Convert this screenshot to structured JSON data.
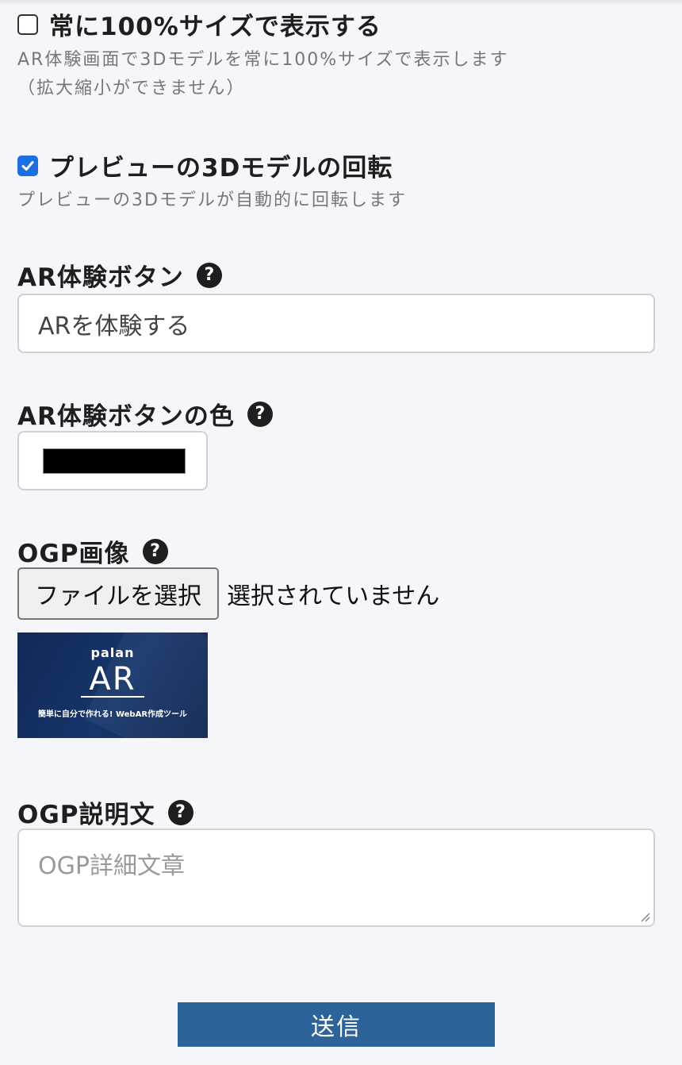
{
  "options": {
    "always_full_size": {
      "label": "常に100%サイズで表示する",
      "checked": false,
      "help_line1": "AR体験画面で3Dモデルを常に100%サイズで表示します",
      "help_line2": "（拡大縮小ができません）"
    },
    "preview_rotation": {
      "label": "プレビューの3Dモデルの回転",
      "checked": true,
      "help": "プレビューの3Dモデルが自動的に回転します"
    }
  },
  "ar_button": {
    "label": "AR体験ボタン",
    "value": "ARを体験する"
  },
  "ar_button_color": {
    "label": "AR体験ボタンの色",
    "value": "#000000"
  },
  "ogp_image": {
    "label": "OGP画像",
    "choose_file_label": "ファイルを選択",
    "file_status": "選択されていません",
    "preview": {
      "brand_small": "palan",
      "brand_large": "AR",
      "tagline": "簡単に自分で作れる! WebAR作成ツール"
    }
  },
  "ogp_description": {
    "label": "OGP説明文",
    "placeholder": "OGP詳細文章"
  },
  "help_icon_glyph": "?",
  "submit_label": "送信",
  "colors": {
    "accent_checkbox": "#1c6fe0",
    "submit_bg": "#2e6399",
    "page_bg": "#f5f6fa"
  }
}
